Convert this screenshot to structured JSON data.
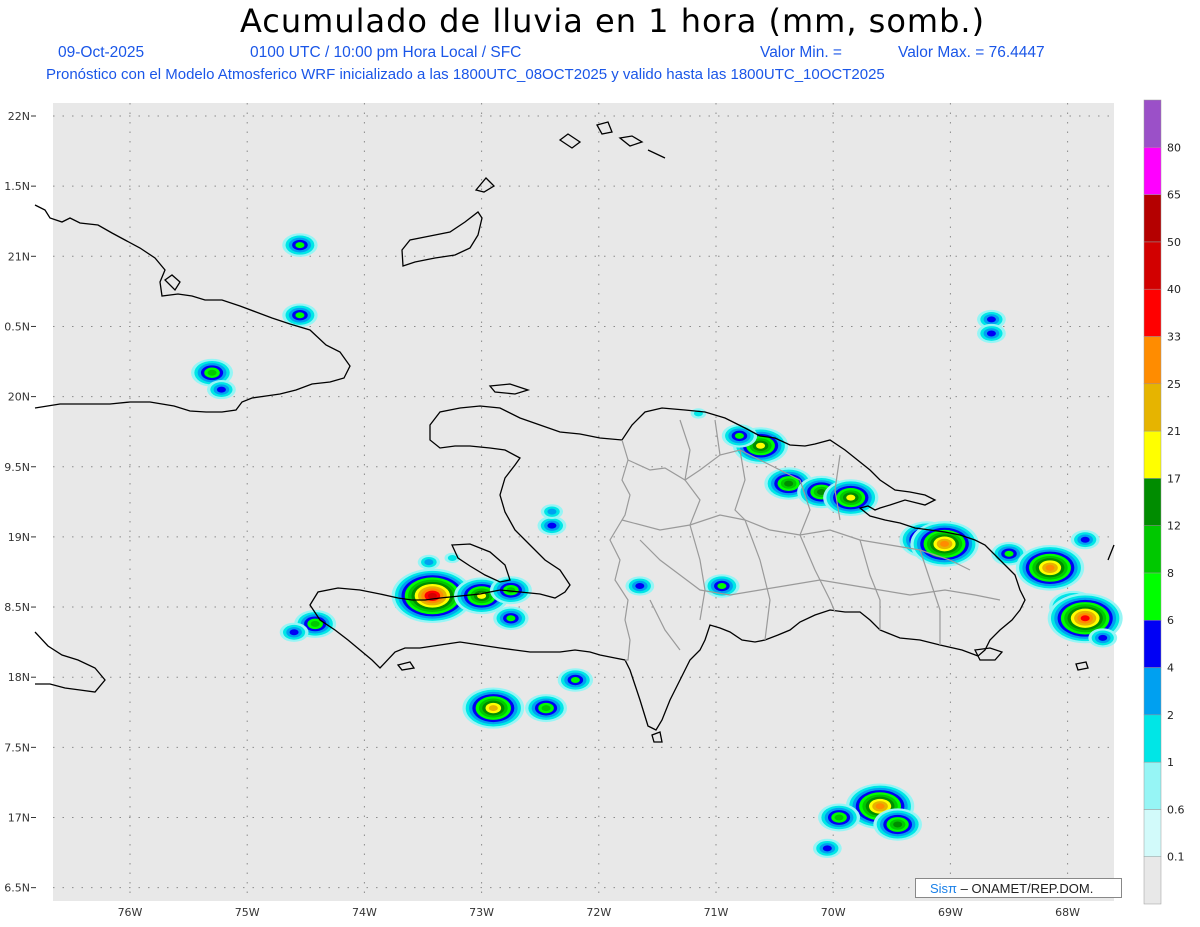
{
  "header": {
    "title": "Acumulado de lluvia en 1 hora (mm, somb.)",
    "date": "09-Oct-2025",
    "time": "0100 UTC / 10:00 pm Hora Local / SFC",
    "vmin_label": "Valor Min. =",
    "vmax_label": "Valor Max. = 76.4447",
    "forecast": "Pronóstico con el Modelo Atmosferico WRF inicializado a las 1800UTC_08OCT2025 y valido hasta las  1800UTC_10OCT2025"
  },
  "map": {
    "lat_labels": [
      "22N",
      "1.5N",
      "21N",
      "0.5N",
      "20N",
      "9.5N",
      "19N",
      "8.5N",
      "18N",
      "7.5N",
      "17N",
      "6.5N"
    ],
    "lon_labels": [
      "76W",
      "75W",
      "74W",
      "73W",
      "72W",
      "71W",
      "70W",
      "69W",
      "68W"
    ],
    "background": "#e8e8e8",
    "coast_color": "#000000",
    "border_color": "#9a9a9a",
    "rain_cells": [
      {
        "lon": -74.55,
        "lat": 21.08,
        "mm": 6
      },
      {
        "lon": -74.55,
        "lat": 20.58,
        "mm": 6
      },
      {
        "lon": -75.3,
        "lat": 20.17,
        "mm": 8
      },
      {
        "lon": -75.22,
        "lat": 20.05,
        "mm": 4
      },
      {
        "lon": -70.62,
        "lat": 19.65,
        "mm": 17
      },
      {
        "lon": -70.8,
        "lat": 19.72,
        "mm": 6
      },
      {
        "lon": -70.38,
        "lat": 19.38,
        "mm": 12
      },
      {
        "lon": -70.1,
        "lat": 19.32,
        "mm": 12
      },
      {
        "lon": -69.85,
        "lat": 19.28,
        "mm": 17
      },
      {
        "lon": -69.2,
        "lat": 18.98,
        "mm": 17
      },
      {
        "lon": -69.05,
        "lat": 18.95,
        "mm": 25
      },
      {
        "lon": -68.5,
        "lat": 18.88,
        "mm": 6
      },
      {
        "lon": -68.15,
        "lat": 18.78,
        "mm": 25
      },
      {
        "lon": -67.95,
        "lat": 18.5,
        "mm": 12
      },
      {
        "lon": -67.85,
        "lat": 18.42,
        "mm": 33
      },
      {
        "lon": -67.7,
        "lat": 18.28,
        "mm": 4
      },
      {
        "lon": -73.42,
        "lat": 18.58,
        "mm": 40
      },
      {
        "lon": -73.0,
        "lat": 18.58,
        "mm": 17
      },
      {
        "lon": -72.75,
        "lat": 18.42,
        "mm": 6
      },
      {
        "lon": -72.75,
        "lat": 18.62,
        "mm": 8
      },
      {
        "lon": -74.42,
        "lat": 18.38,
        "mm": 8
      },
      {
        "lon": -74.6,
        "lat": 18.32,
        "mm": 4
      },
      {
        "lon": -72.9,
        "lat": 17.78,
        "mm": 21
      },
      {
        "lon": -72.45,
        "lat": 17.78,
        "mm": 8
      },
      {
        "lon": -72.2,
        "lat": 17.98,
        "mm": 6
      },
      {
        "lon": -72.4,
        "lat": 19.08,
        "mm": 4
      },
      {
        "lon": -72.4,
        "lat": 19.18,
        "mm": 2
      },
      {
        "lon": -71.65,
        "lat": 18.65,
        "mm": 4
      },
      {
        "lon": -70.95,
        "lat": 18.65,
        "mm": 6
      },
      {
        "lon": -69.6,
        "lat": 17.08,
        "mm": 25
      },
      {
        "lon": -69.45,
        "lat": 16.95,
        "mm": 12
      },
      {
        "lon": -69.95,
        "lat": 17.0,
        "mm": 8
      },
      {
        "lon": -70.05,
        "lat": 16.78,
        "mm": 4
      },
      {
        "lon": -68.65,
        "lat": 20.55,
        "mm": 4
      },
      {
        "lon": -68.65,
        "lat": 20.45,
        "mm": 4
      },
      {
        "lon": -67.85,
        "lat": 18.98,
        "mm": 4
      },
      {
        "lon": -73.45,
        "lat": 18.82,
        "mm": 2
      },
      {
        "lon": -73.25,
        "lat": 18.85,
        "mm": 1
      },
      {
        "lon": -71.15,
        "lat": 19.88,
        "mm": 1
      }
    ]
  },
  "colorbar": {
    "levels": [
      "0.1",
      "0.6",
      "1",
      "2",
      "4",
      "6",
      "8",
      "12",
      "17",
      "21",
      "25",
      "33",
      "40",
      "50",
      "65",
      "80"
    ],
    "colors": [
      "#e8e8e8",
      "#d2fafa",
      "#96f5f5",
      "#00e6e6",
      "#00a0f0",
      "#0000f5",
      "#00ff00",
      "#00c800",
      "#008c00",
      "#ffff00",
      "#e6b400",
      "#ff8c00",
      "#ff0000",
      "#d20000",
      "#b40000",
      "#ff00ff",
      "#9b50c8"
    ]
  },
  "credit": {
    "brand": "Sisπ",
    "org": " – ONAMET/REP.DOM."
  }
}
